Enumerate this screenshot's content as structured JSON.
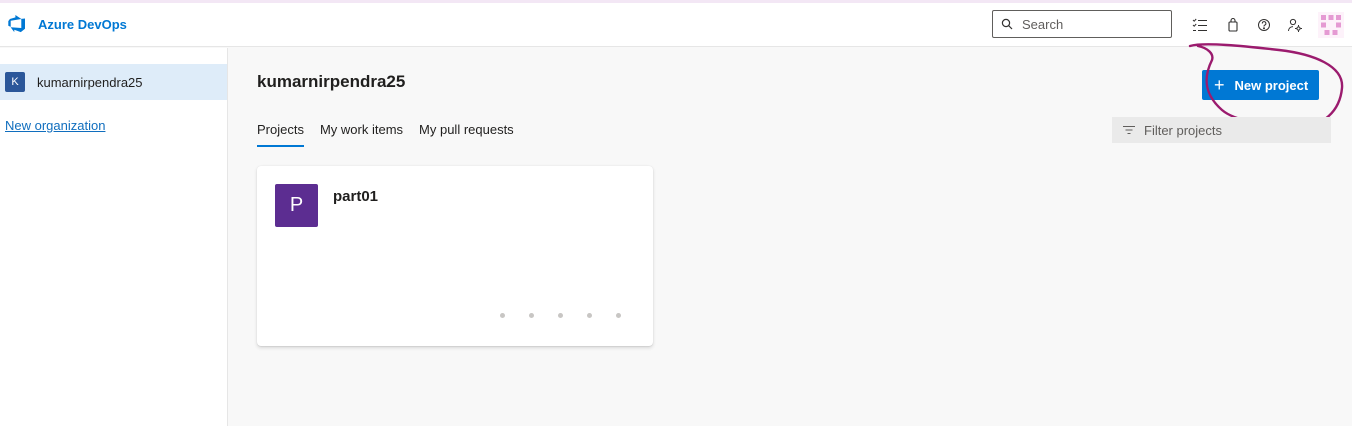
{
  "app": {
    "name": "Azure DevOps",
    "brand_color": "#0078d4"
  },
  "topbar": {
    "search_placeholder": "Search",
    "icons": [
      "checklist-icon",
      "marketplace-bag-icon",
      "help-icon",
      "user-settings-icon",
      "avatar"
    ]
  },
  "sidebar": {
    "organizations": [
      {
        "badge": "K",
        "name": "kumarnirpendra25",
        "selected": true
      }
    ],
    "new_org_label": "New organization"
  },
  "main": {
    "title": "kumarnirpendra25",
    "new_project_label": "New project",
    "tabs": [
      {
        "label": "Projects",
        "active": true
      },
      {
        "label": "My work items",
        "active": false
      },
      {
        "label": "My pull requests",
        "active": false
      }
    ],
    "filter_placeholder": "Filter projects",
    "projects": [
      {
        "initial": "P",
        "name": "part01",
        "color": "#5c2d91"
      }
    ]
  },
  "annotation_color": "#9b1b6e"
}
